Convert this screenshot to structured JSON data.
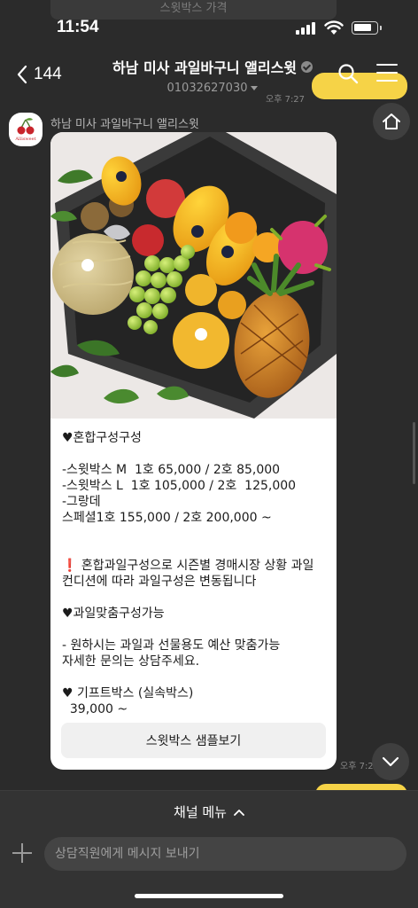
{
  "ghost_card_text": "스윗박스 가격",
  "status_bar": {
    "time": "11:54",
    "battery_level": 0.8
  },
  "header": {
    "back_count": "144",
    "title": "하남 미사 과일바구니 앨리스윗",
    "phone": "01032627030"
  },
  "timestamps": {
    "top": "오후 7:27",
    "card": "오후 7:2"
  },
  "message": {
    "sender": "하남 미사 과일바구니 앨리스윗",
    "lines": [
      "♥혼합구성구성",
      "",
      "-스윗박스 M  1호 65,000 / 2호 85,000",
      "-스윗박스 L  1호 105,000 / 2호  125,000",
      "-그랑데",
      "스페셜1호 155,000 / 2호 200,000 ~",
      "",
      "",
      "❗ 혼합과일구성으로 시즌별 경매시장 상황 과일",
      "컨디션에 따라 과일구성은 변동됩니다",
      "",
      "♥과일맞춤구성가능",
      "",
      "- 원하시는 과일과 선물용도 예산 맞춤가능",
      "자세한 문의는 상담주세요.",
      "",
      "♥ 기프트박스 (실속박스)",
      "  39,000 ~"
    ],
    "button_label": "스윗박스 샘플보기"
  },
  "bottom": {
    "channel_menu": "채널 메뉴",
    "input_placeholder": "상담직원에게 메시지 보내기"
  },
  "colors": {
    "accent_yellow": "#f6d347",
    "background": "#2b2b2b",
    "card": "#ffffff"
  },
  "icons": [
    "back-arrow-icon",
    "verified-icon",
    "caret-down-icon",
    "search-icon",
    "menu-icon",
    "home-icon",
    "chevron-down-icon",
    "chevron-up-icon",
    "plus-icon"
  ]
}
